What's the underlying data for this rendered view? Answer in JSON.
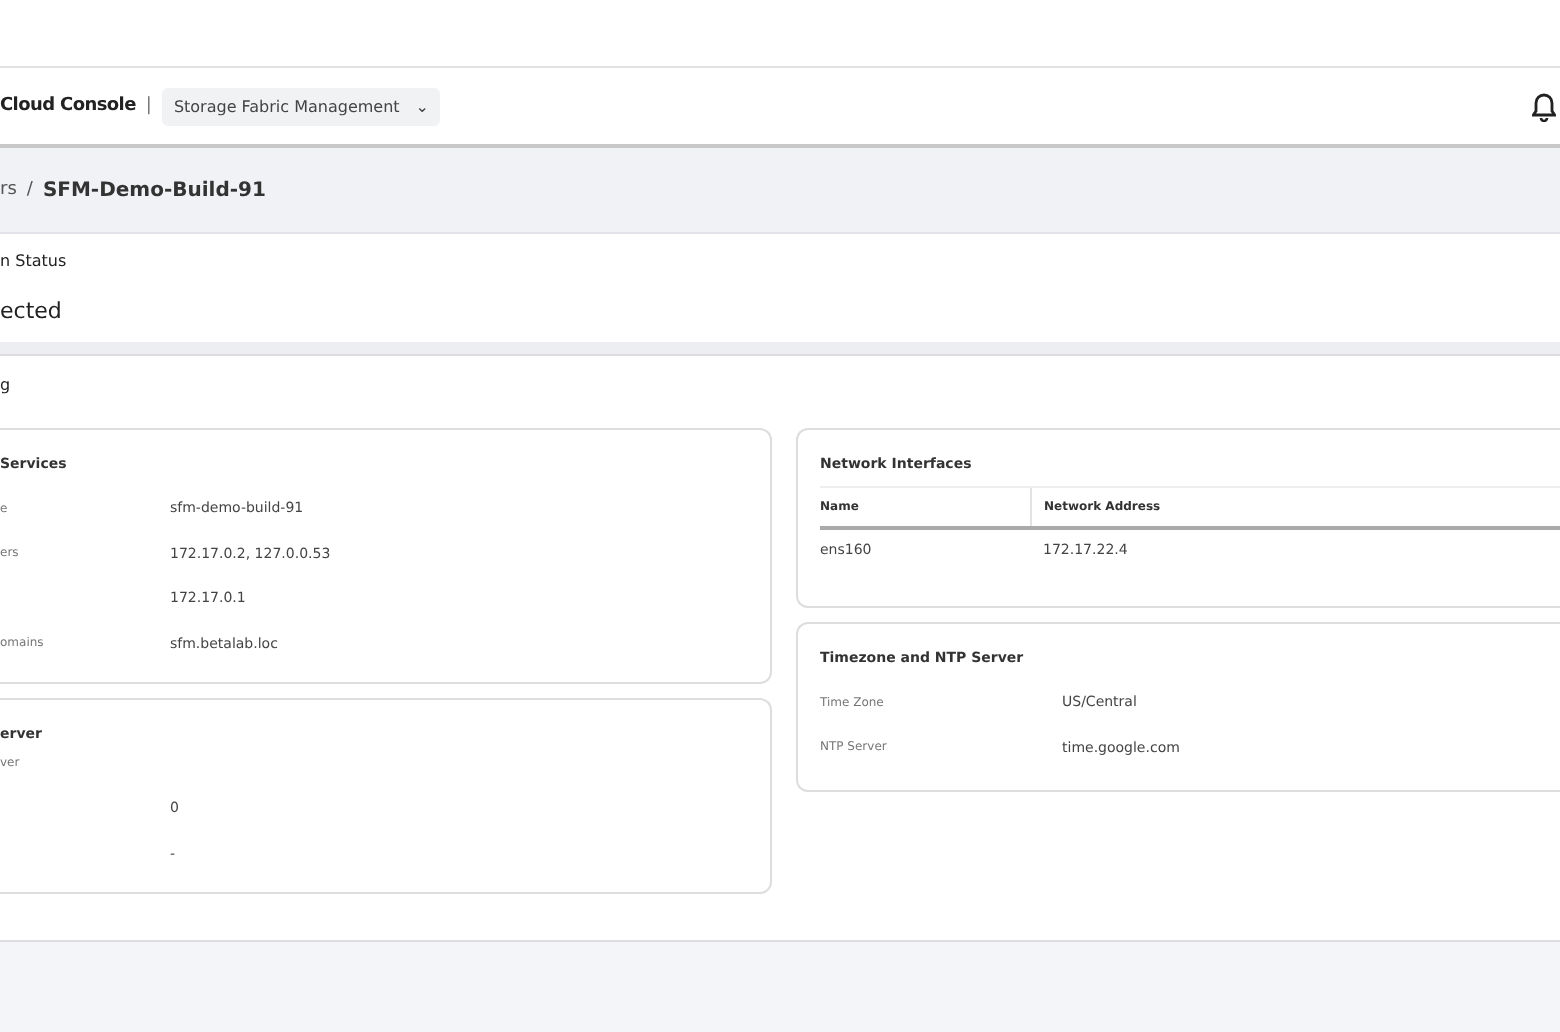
{
  "header": {
    "app_title": "Cloud Console",
    "separator": "|",
    "app_switcher": {
      "label": "Storage Fabric Management",
      "caret": "⌄"
    }
  },
  "breadcrumb": {
    "parent": "rs",
    "separator": "/",
    "current": "SFM-Demo-Build-91"
  },
  "status": {
    "label": "n Status",
    "value": "ected"
  },
  "section": {
    "title": "g"
  },
  "left_cards": [
    {
      "title": "Services",
      "rows": [
        {
          "label": "e",
          "value": "sfm-demo-build-91"
        },
        {
          "label": "ers",
          "value": "172.17.0.2, 127.0.0.53"
        },
        {
          "label": "",
          "value": "172.17.0.1"
        },
        {
          "label": "omains",
          "value": "sfm.betalab.loc"
        }
      ]
    },
    {
      "title": "erver",
      "subtitle": "ver",
      "rows": [
        {
          "label": "",
          "value": "0"
        },
        {
          "label": "",
          "value": "-"
        }
      ]
    }
  ],
  "network_interfaces": {
    "title": "Network Interfaces",
    "columns": [
      "Name",
      "Network Address"
    ],
    "rows": [
      [
        "ens160",
        "172.17.22.4"
      ]
    ]
  },
  "timezone": {
    "title": "Timezone and NTP Server",
    "rows": [
      {
        "label": "Time Zone",
        "value": "US/Central"
      },
      {
        "label": "NTP Server",
        "value": "time.google.com"
      }
    ]
  }
}
